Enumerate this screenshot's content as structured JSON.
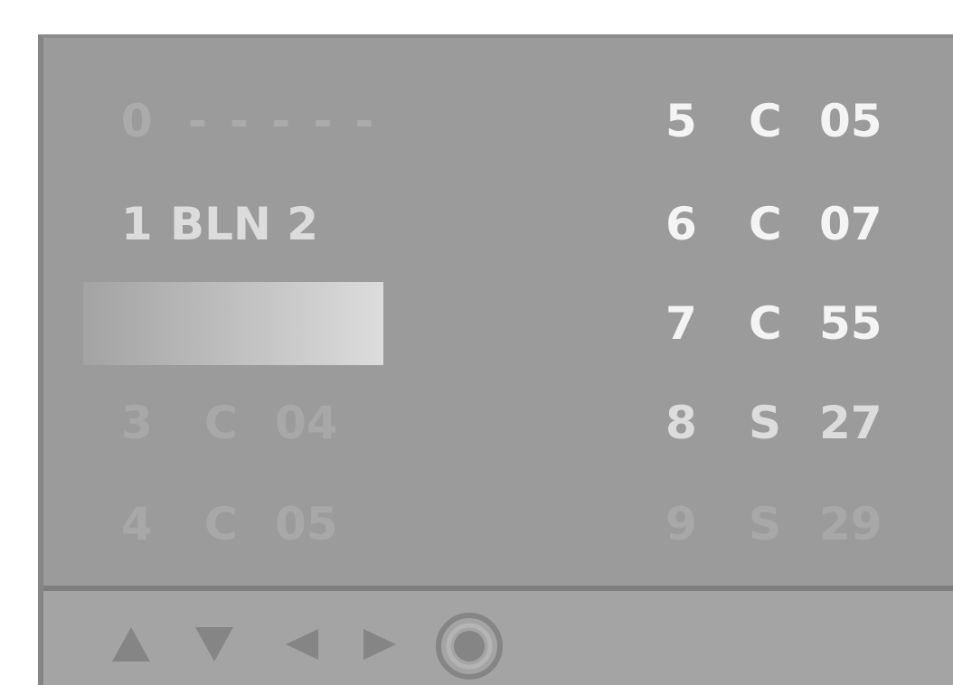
{
  "channel_list": {
    "left_column": [
      {
        "num": "0",
        "type": "",
        "channel": "",
        "name": "- - - - -",
        "state": "dim"
      },
      {
        "num": "1",
        "type": "",
        "channel": "",
        "name": "BLN 2",
        "state": "mid"
      },
      {
        "num": "",
        "type": "",
        "channel": "",
        "name": "",
        "state": "selected"
      },
      {
        "num": "3",
        "type": "C",
        "channel": "04",
        "name": "",
        "state": "faint"
      },
      {
        "num": "4",
        "type": "C",
        "channel": "05",
        "name": "",
        "state": "faint"
      }
    ],
    "right_column": [
      {
        "num": "5",
        "type": "C",
        "channel": "05",
        "state": "bright"
      },
      {
        "num": "6",
        "type": "C",
        "channel": "07",
        "state": "bright"
      },
      {
        "num": "7",
        "type": "C",
        "channel": "55",
        "state": "bright"
      },
      {
        "num": "8",
        "type": "S",
        "channel": "27",
        "state": "mid"
      },
      {
        "num": "9",
        "type": "S",
        "channel": "29",
        "state": "faint"
      }
    ]
  },
  "nav": {
    "icons": [
      "up-arrow-icon",
      "down-arrow-icon",
      "left-arrow-icon",
      "right-arrow-icon",
      "ok-button-icon"
    ]
  },
  "colors": {
    "panel_bg": "#9b9b9b",
    "nav_bg": "#a4a4a4",
    "text_bright": "#f4f4f4",
    "text_faint": "#a8a8a8"
  }
}
